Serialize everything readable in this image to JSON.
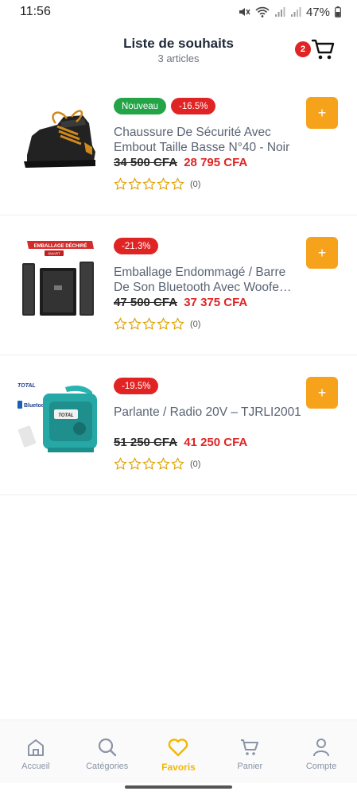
{
  "status_bar": {
    "time": "11:56",
    "battery": "47%"
  },
  "header": {
    "title": "Liste de souhaits",
    "subtitle": "3 articles",
    "cart_count": "2"
  },
  "products": [
    {
      "badges": [
        "Nouveau",
        "-16.5%"
      ],
      "title": "Chaussure De Sécurité Avec Embout Taille Basse N°40 - Noir",
      "old_price": "34 500 CFA",
      "new_price": "28 795 CFA",
      "rating_count": "(0)",
      "image_label": "safety-boot"
    },
    {
      "badges": [
        "-21.3%"
      ],
      "title": "Emballage Endommagé / Barre De Son Bluetooth Avec Woofe…",
      "old_price": "47 500 CFA",
      "new_price": "37 375 CFA",
      "rating_count": "(0)",
      "image_label": "speaker-set",
      "image_texts": {
        "banner": "EMBALLAGE DÉCHIRÉ",
        "brand": "SMART"
      }
    },
    {
      "badges": [
        "-19.5%"
      ],
      "title": "Parlante / Radio 20V – TJRLI2001",
      "old_price": "51 250 CFA",
      "new_price": "41 250 CFA",
      "rating_count": "(0)",
      "image_label": "jobsite-radio",
      "image_texts": {
        "brand": "TOTAL",
        "feature": "Bluetooth",
        "device_brand": "TOTAL"
      }
    }
  ],
  "add_button_symbol": "+",
  "bottom_nav": [
    {
      "label": "Accueil",
      "icon": "home-icon"
    },
    {
      "label": "Catégories",
      "icon": "search-icon"
    },
    {
      "label": "Favoris",
      "icon": "heart-icon",
      "active": true
    },
    {
      "label": "Panier",
      "icon": "cart-icon"
    },
    {
      "label": "Compte",
      "icon": "user-icon"
    }
  ],
  "colors": {
    "accent": "#f7a21b",
    "discount": "#e02424",
    "new_badge": "#22a447",
    "active_nav": "#f2b705"
  }
}
